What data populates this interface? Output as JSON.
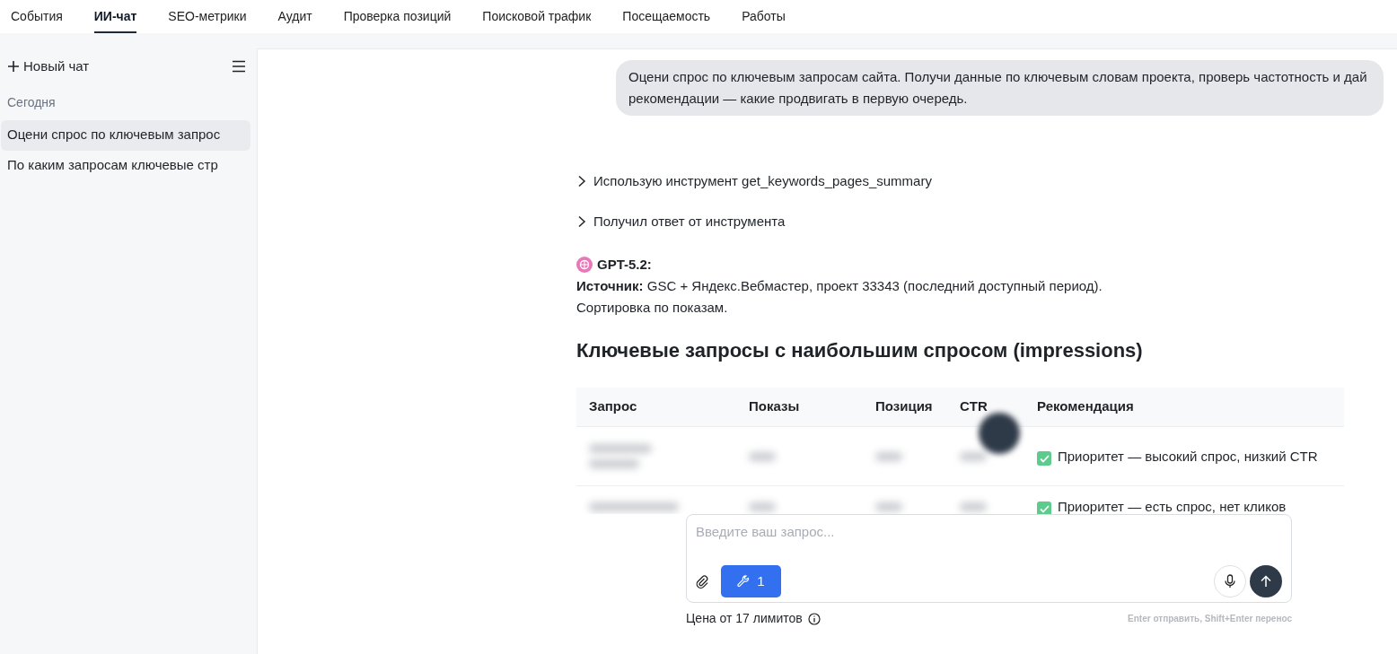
{
  "nav_tabs": [
    {
      "label": "События",
      "selected": false
    },
    {
      "label": "ИИ-чат",
      "selected": true
    },
    {
      "label": "SEO-метрики",
      "selected": false
    },
    {
      "label": "Аудит",
      "selected": false
    },
    {
      "label": "Проверка позиций",
      "selected": false
    },
    {
      "label": "Поисковой трафик",
      "selected": false
    },
    {
      "label": "Посещаемость",
      "selected": false
    },
    {
      "label": "Работы",
      "selected": false
    }
  ],
  "sidebar": {
    "new_chat": "Новый чат",
    "group": "Сегодня",
    "items": [
      {
        "label": "Оцени спрос по ключевым запрос",
        "selected": true
      },
      {
        "label": "По каким запросам ключевые стр",
        "selected": false
      }
    ]
  },
  "chat": {
    "user_message": "Оцени спрос по ключевым запросам сайта. Получи данные по ключевым словам проекта, проверь частотность и дай рекомендации — какие продвигать в первую очередь.",
    "tool_steps": [
      {
        "label": "Использую инструмент get_keywords_pages_summary",
        "expanded": false
      },
      {
        "label": "Получил ответ от инструмента",
        "expanded": false
      }
    ],
    "model": "GPT-5.2:",
    "source_line": "**Источник:** GSC + Яндекс.Вебмастер, проект 33343 (последний доступный период).",
    "sort_line": "Сортировка по показам.",
    "heading": "Ключевые запросы с наибольшим спросом (impressions)",
    "table": {
      "columns": [
        "Запрос",
        "Показы",
        "Позиция",
        "CTR",
        "Рекомендация"
      ],
      "rows": [
        {
          "cells": [
            {
              "kind": "blurred"
            },
            {
              "kind": "blurred"
            },
            {
              "kind": "blurred"
            },
            {
              "kind": "blurred"
            },
            {
              "kind": "check",
              "text": "Приоритет — высокий спрос, низкий CTR"
            }
          ]
        },
        {
          "cells": [
            {
              "kind": "blurred"
            },
            {
              "kind": "blurred"
            },
            {
              "kind": "blurred"
            },
            {
              "kind": "blurred"
            },
            {
              "kind": "check",
              "text": "Приоритет — есть спрос, нет кликов"
            }
          ]
        }
      ]
    }
  },
  "composer": {
    "placeholder": "Введите ваш запрос...",
    "tools_count": "1",
    "price": "Цена от 17 лимитов",
    "hint": "Enter отправить, Shift+Enter перенос"
  }
}
